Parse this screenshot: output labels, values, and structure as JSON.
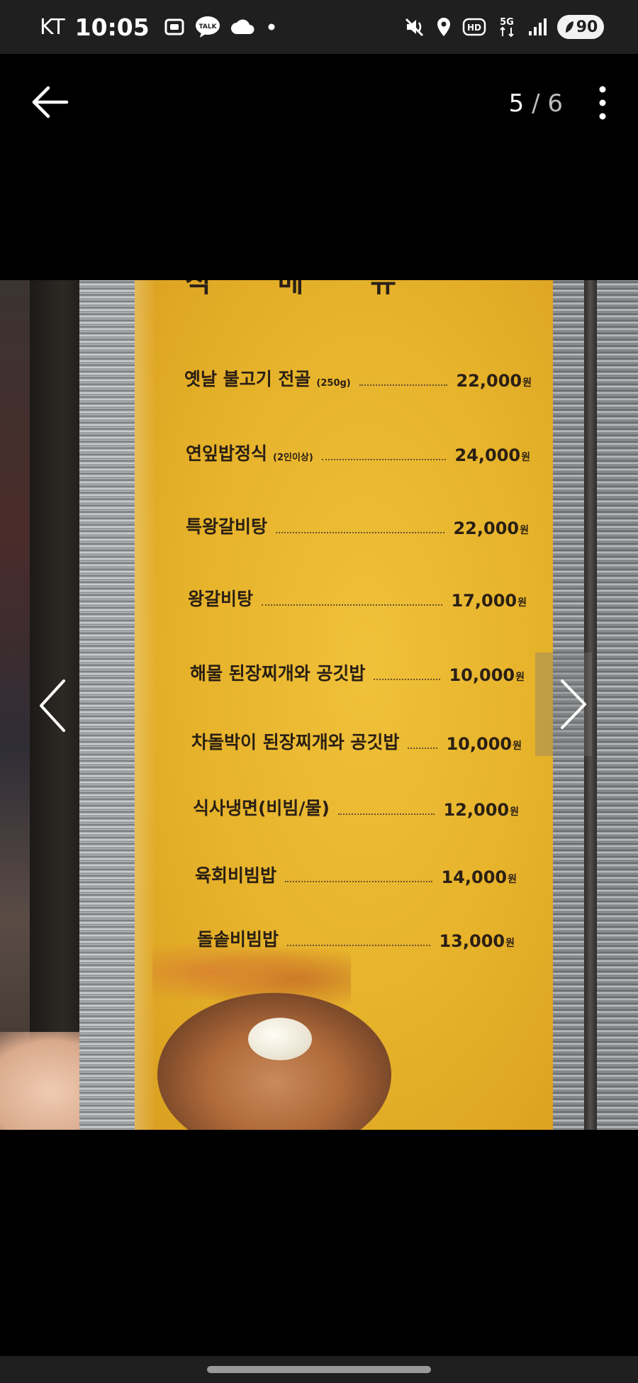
{
  "status_bar": {
    "carrier": "KT",
    "time": "10:05",
    "left_icons": [
      "screenshot-icon",
      "kakaotalk-icon",
      "cloud-icon",
      "dot-icon"
    ],
    "kakaotalk_badge": "TALK",
    "right_icons": [
      "mute-vibrate-icon",
      "location-icon",
      "hd-icon",
      "5g-icon",
      "signal-icon"
    ],
    "hd_label": "HD",
    "network_label": "5G",
    "battery_level": "90"
  },
  "viewer": {
    "current_page": "5",
    "separator": "/",
    "total_pages": "6"
  },
  "menu": {
    "title": "식 메 뉴",
    "items": [
      {
        "name": "옛날 불고기 전골",
        "note": "(250g)",
        "price": "22,000",
        "unit": "원"
      },
      {
        "name": "연잎밥정식",
        "note": "(2인이상)",
        "price": "24,000",
        "unit": "원"
      },
      {
        "name": "특왕갈비탕",
        "note": "",
        "price": "22,000",
        "unit": "원"
      },
      {
        "name": "왕갈비탕",
        "note": "",
        "price": "17,000",
        "unit": "원"
      },
      {
        "name": "해물 된장찌개와 공깃밥",
        "note": "",
        "price": "10,000",
        "unit": "원"
      },
      {
        "name": "차돌박이 된장찌개와 공깃밥",
        "note": "",
        "price": "10,000",
        "unit": "원"
      },
      {
        "name": "식사냉면(비빔/물)",
        "note": "",
        "price": "12,000",
        "unit": "원"
      },
      {
        "name": "육회비빔밥",
        "note": "",
        "price": "14,000",
        "unit": "원"
      },
      {
        "name": "돌솥비빔밥",
        "note": "",
        "price": "13,000",
        "unit": "원"
      }
    ]
  },
  "colors": {
    "status_bar_bg": "#1f1f1f",
    "background": "#000000",
    "menu_paper": "#e6b22a",
    "menu_text": "#2a1f14"
  }
}
